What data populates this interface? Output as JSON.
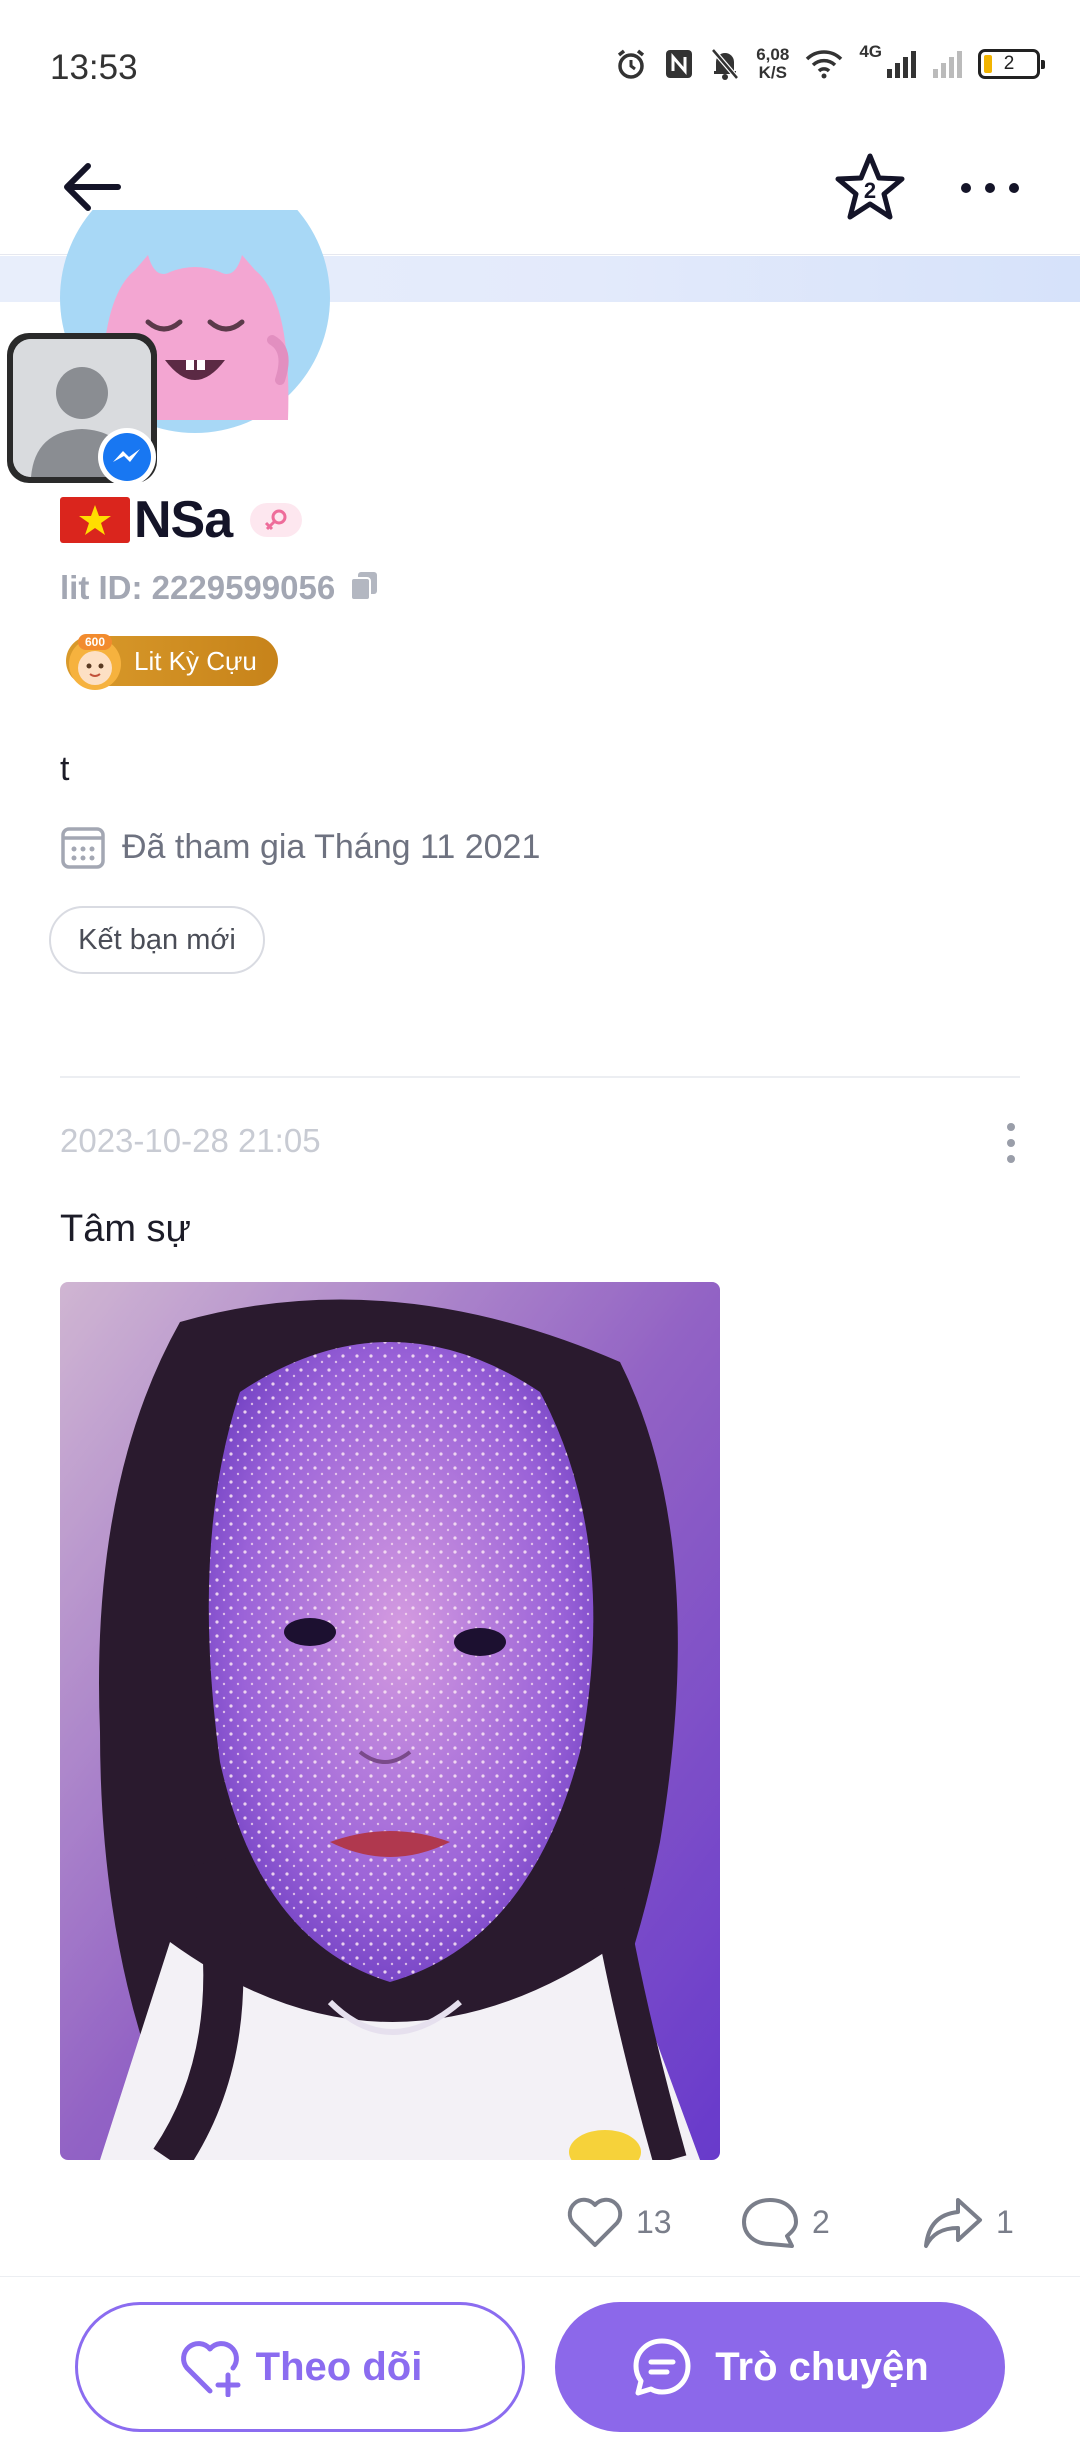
{
  "status_bar": {
    "time": "13:53",
    "net_speed_value": "6,08",
    "net_speed_unit": "K/S",
    "network_label": "4G",
    "battery_level": "2",
    "icons": [
      "alarm-icon",
      "nfc-icon",
      "mute-bell-icon",
      "wifi-icon",
      "signal-icon",
      "battery-icon"
    ]
  },
  "nav": {
    "back_icon": "arrow-left-icon",
    "favorite_icon": "star-icon",
    "favorite_badge": "2",
    "more_icon": "more-horizontal-icon"
  },
  "profile": {
    "name": "NSa",
    "country_flag": "vietnam-flag",
    "gender_icon": "female-icon",
    "lit_id": "lit ID: 2229599056",
    "level_number": "600",
    "level_badge": "Lit Kỳ Cựu",
    "bio": "t",
    "joined": "Đã tham gia Tháng 11 2021",
    "tag": "Kết bạn mới"
  },
  "post": {
    "timestamp": "2023-10-28 21:05",
    "text": "Tâm sự",
    "likes": "13",
    "comments": "2",
    "shares": "1"
  },
  "actions": {
    "follow_label": "Theo dõi",
    "chat_label": "Trò chuyện"
  },
  "colors": {
    "accent": "#8c68ea",
    "badge_gold": "#d1901f",
    "muted_text": "#a3a7b3"
  }
}
